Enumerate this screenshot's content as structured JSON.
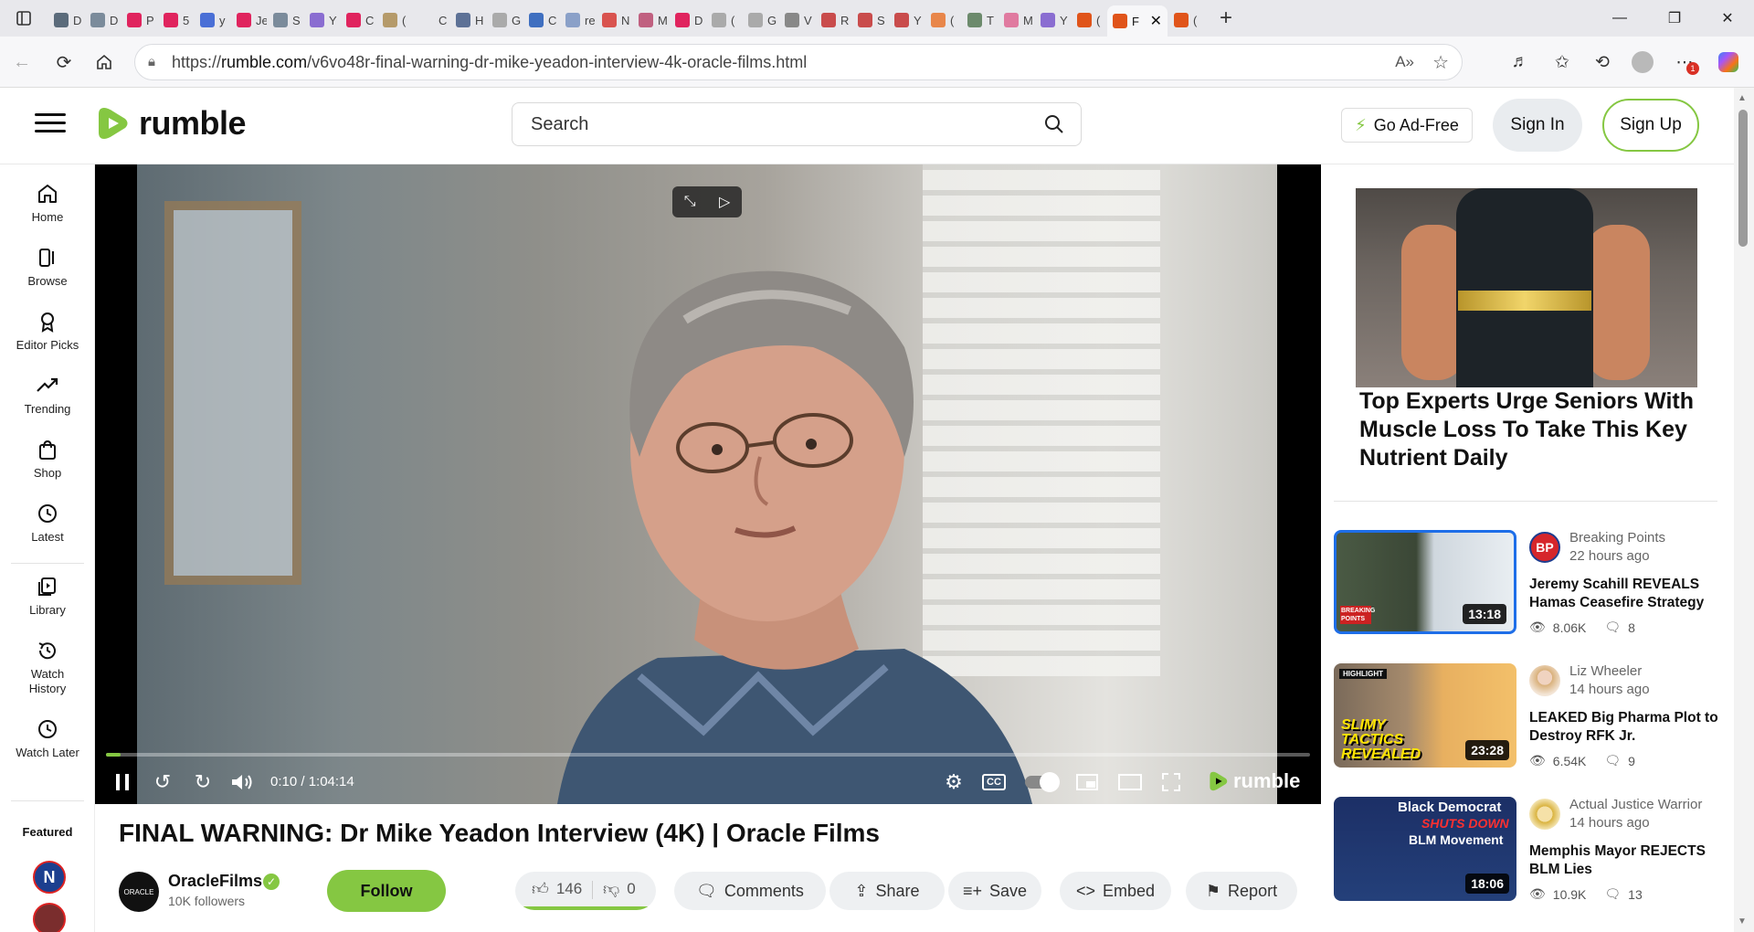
{
  "browser": {
    "tabs": [
      {
        "title": "D",
        "color": "#5b6b7b"
      },
      {
        "title": "D",
        "color": "#7b8b9b"
      },
      {
        "title": "P",
        "color": "#e0245e"
      },
      {
        "title": "5",
        "color": "#e0245e"
      },
      {
        "title": "y",
        "color": "#4a6fd6"
      },
      {
        "title": "Je",
        "color": "#e0245e"
      },
      {
        "title": "S",
        "color": "#7b8b9b"
      },
      {
        "title": "Y",
        "color": "#8a6dd1"
      },
      {
        "title": "C",
        "color": "#e0245e"
      },
      {
        "title": "(",
        "color": "#b59a6a"
      },
      {
        "title": "C",
        "color": "#e8e8ec"
      },
      {
        "title": "H",
        "color": "#5d7196"
      },
      {
        "title": "G",
        "color": "#aaaaaa"
      },
      {
        "title": "C",
        "color": "#3f6fc0"
      },
      {
        "title": "re",
        "color": "#8aa0c8"
      },
      {
        "title": "N",
        "color": "#d9534f"
      },
      {
        "title": "M",
        "color": "#c06080"
      },
      {
        "title": "D",
        "color": "#e0245e"
      },
      {
        "title": "(",
        "color": "#aaaaaa"
      },
      {
        "title": "G",
        "color": "#aaaaaa"
      },
      {
        "title": "V",
        "color": "#888888"
      },
      {
        "title": "R",
        "color": "#c94c4c"
      },
      {
        "title": "S",
        "color": "#c94c4c"
      },
      {
        "title": "Y",
        "color": "#c94c4c"
      },
      {
        "title": "(",
        "color": "#e8864a"
      },
      {
        "title": "T",
        "color": "#6c8a6c"
      },
      {
        "title": "M",
        "color": "#e07aa0"
      },
      {
        "title": "Y",
        "color": "#8a6dd1"
      },
      {
        "title": "(",
        "color": "#e0541a"
      }
    ],
    "active_tab": {
      "title": "F",
      "color": "#e0541a"
    },
    "last_tab": {
      "title": "(",
      "color": "#e0541a"
    },
    "url_prefix": "https://",
    "url_host": "rumble.com",
    "url_path": "/v6vo48r-final-warning-dr-mike-yeadon-interview-4k-oracle-films.html",
    "notification_count": "1"
  },
  "header": {
    "logo_text": "rumble",
    "search_placeholder": "Search",
    "go_adfree": "Go Ad-Free",
    "sign_in": "Sign In",
    "sign_up": "Sign Up",
    "accent_color": "#85c742"
  },
  "sidebar": {
    "items": [
      {
        "label": "Home",
        "icon": "home-icon"
      },
      {
        "label": "Browse",
        "icon": "browse-icon"
      },
      {
        "label": "Editor Picks",
        "icon": "editor-picks-icon"
      },
      {
        "label": "Trending",
        "icon": "trending-icon"
      },
      {
        "label": "Shop",
        "icon": "shop-icon"
      },
      {
        "label": "Latest",
        "icon": "latest-icon"
      },
      {
        "label": "Library",
        "icon": "library-icon"
      },
      {
        "label": "Watch History",
        "icon": "history-icon"
      },
      {
        "label": "Watch Later",
        "icon": "watch-later-icon"
      }
    ],
    "featured_label": "Featured"
  },
  "player": {
    "time": "0:10 / 1:04:14",
    "progress_fraction": 0.0026,
    "logo_text": "rumble"
  },
  "video": {
    "title": "FINAL WARNING: Dr Mike Yeadon Interview (4K) | Oracle Films",
    "channel_name": "OracleFilms",
    "channel_avatar_text": "ORACLE",
    "followers": "10K followers",
    "follow_label": "Follow",
    "likes": "146",
    "dislikes": "0",
    "actions": {
      "comments": "Comments",
      "share": "Share",
      "save": "Save",
      "embed": "Embed",
      "report": "Report"
    }
  },
  "ad": {
    "headline": "Top Experts Urge Seniors With Muscle Loss To Take This Key Nutrient Daily"
  },
  "related": [
    {
      "channel": "Breaking Points",
      "ago": "22 hours ago",
      "title": "Jeremy Scahill REVEALS Hamas Ceasefire Strategy",
      "duration": "13:18",
      "views": "8.06K",
      "comments": "8",
      "thumb_label": "BREAKING POINTS",
      "avatar_text": "BP"
    },
    {
      "channel": "Liz Wheeler",
      "ago": "14 hours ago",
      "title": "LEAKED Big Pharma Plot to Destroy RFK Jr.",
      "duration": "23:28",
      "views": "6.54K",
      "comments": "9",
      "thumb_badge": "HIGHLIGHT",
      "thumb_text": "SLIMY TACTICS REVEALED"
    },
    {
      "channel": "Actual Justice Warrior",
      "ago": "14 hours ago",
      "title": "Memphis Mayor REJECTS BLM Lies",
      "duration": "18:06",
      "views": "10.9K",
      "comments": "13",
      "thumb_text_1": "Black Democrat",
      "thumb_text_2": "SHUTS DOWN",
      "thumb_text_3": "BLM Movement"
    }
  ]
}
